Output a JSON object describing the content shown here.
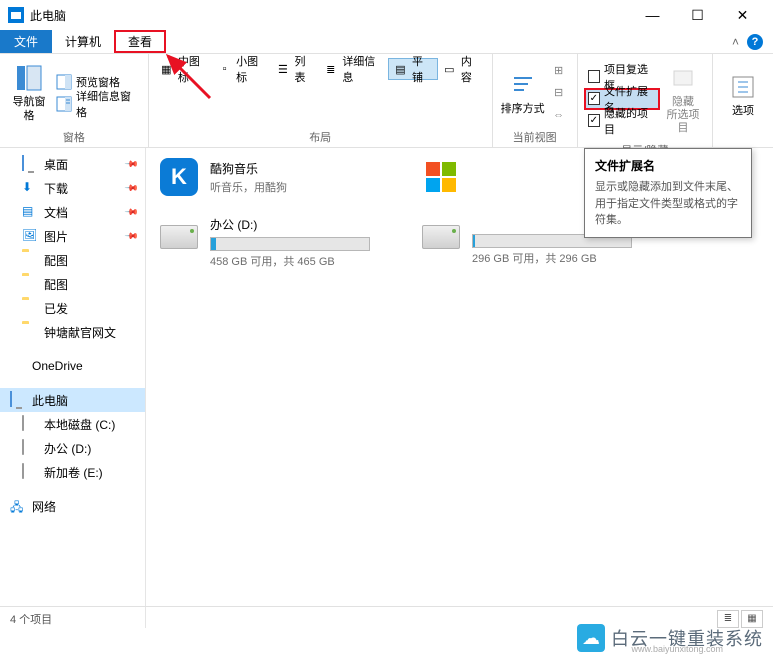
{
  "window": {
    "title": "此电脑"
  },
  "menubar": {
    "file": "文件",
    "computer": "计算机",
    "view": "查看"
  },
  "ribbon": {
    "panes": {
      "label": "窗格",
      "nav": "导航窗格",
      "preview": "预览窗格",
      "details": "详细信息窗格"
    },
    "layout": {
      "label": "布局",
      "medium": "中图标",
      "small": "小图标",
      "list": "列表",
      "detail": "详细信息",
      "tiles": "平铺",
      "content": "内容"
    },
    "currentview": {
      "label": "当前视图",
      "sort": "排序方式"
    },
    "showhide": {
      "label": "显示/隐藏",
      "checkboxes": "项目复选框",
      "extensions": "文件扩展名",
      "hiddenitems": "隐藏的项目",
      "hide": "隐藏",
      "hidesub": "所选项目"
    },
    "options": {
      "label": "选项"
    }
  },
  "sidebar": {
    "desktop": "桌面",
    "downloads": "下载",
    "documents": "文档",
    "pictures": "图片",
    "peitu1": "配图",
    "peitu2": "配图",
    "sent": "已发",
    "zhongtang": "钟塘献官网文",
    "onedrive": "OneDrive",
    "thispc": "此电脑",
    "localc": "本地磁盘 (C:)",
    "office": "办公 (D:)",
    "newvol": "新加卷 (E:)",
    "network": "网络"
  },
  "items": {
    "kugou": {
      "name": "酷狗音乐",
      "desc": "听音乐，用酷狗"
    },
    "driveD": {
      "name": "办公 (D:)",
      "desc": "458 GB 可用，共 465 GB",
      "fillPct": 3
    },
    "driveE": {
      "desc": "296 GB 可用，共 296 GB",
      "fillPct": 1
    }
  },
  "tooltip": {
    "title": "文件扩展名",
    "body": "显示或隐藏添加到文件末尾、用于指定文件类型或格式的字符集。"
  },
  "status": {
    "count": "4 个项目"
  },
  "watermark": {
    "text": "白云一键重装系统",
    "url": "www.baiyunxitong.com"
  }
}
